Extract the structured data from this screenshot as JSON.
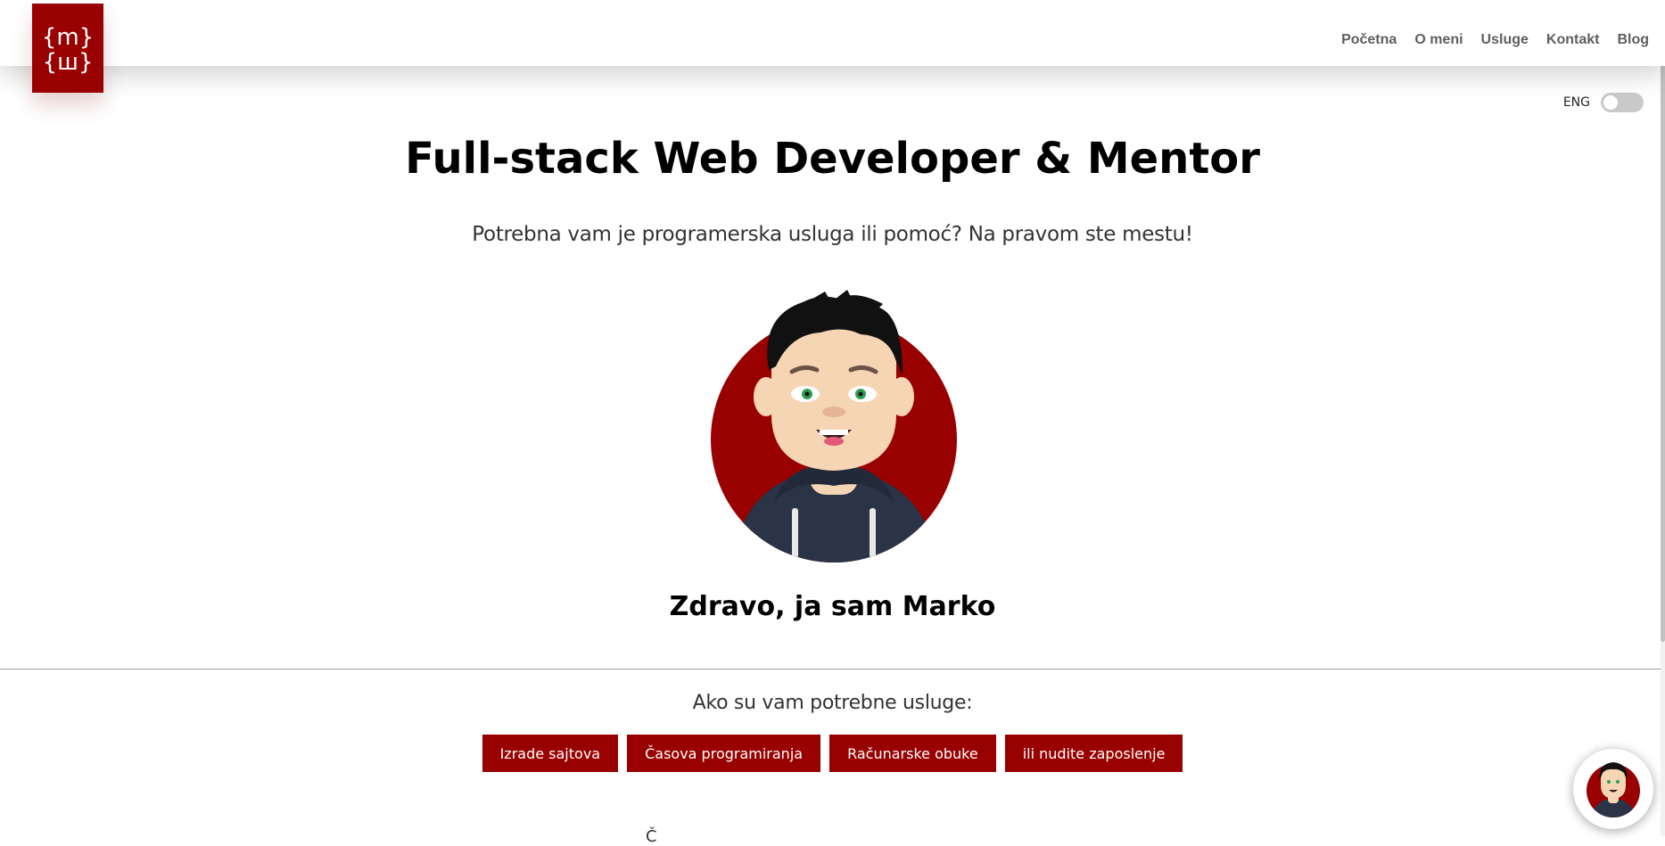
{
  "logo": {
    "text_top": "{m}",
    "text_bottom": "{ш}"
  },
  "nav": {
    "items": [
      "Početna",
      "O meni",
      "Usluge",
      "Kontakt",
      "Blog"
    ]
  },
  "language": {
    "label": "ENG",
    "enabled": false
  },
  "hero": {
    "title": "Full-stack Web Developer & Mentor",
    "subtitle": "Potrebna vam je programerska usluga ili pomoć? Na pravom ste mestu!",
    "greeting": "Zdravo, ja sam Marko"
  },
  "services": {
    "label": "Ako su vam potrebne usluge:",
    "buttons": [
      "Izrade sajtova",
      "Časova programiranja",
      "Računarske obuke",
      "ili nudite zaposlenje"
    ]
  },
  "below_fold": {
    "partial_text": "Č"
  },
  "colors": {
    "brand": "#990000",
    "nav_text": "#5f5f5f",
    "hoodie": "#2b3447",
    "skin": "#f6d5b4",
    "hair": "#111111",
    "eyes": "#2e9e4f"
  },
  "icons": {
    "logo": "curly-brace-m-logo",
    "avatar": "cartoon-developer-avatar",
    "chat": "chat-avatar-icon"
  }
}
